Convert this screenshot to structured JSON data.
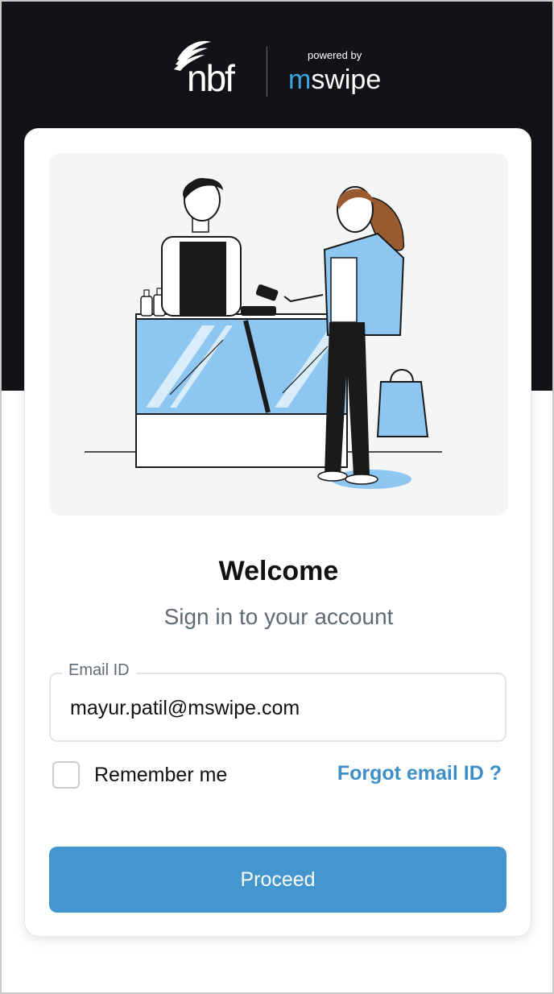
{
  "header": {
    "brand_primary": "nbf",
    "powered_by_label": "powered by",
    "brand_secondary_prefix": "m",
    "brand_secondary_suffix": "swipe"
  },
  "login": {
    "title": "Welcome",
    "subtitle": "Sign in to your account",
    "email_label": "Email ID",
    "email_value": "mayur.patil@mswipe.com",
    "remember_label": "Remember me",
    "remember_checked": false,
    "forgot_label": "Forgot email ID ?",
    "proceed_label": "Proceed"
  },
  "colors": {
    "header_background": "#121317",
    "accent_blue": "#4396ce",
    "link_blue": "#3d8fc6",
    "mswipe_accent": "#3aa6e0"
  },
  "icons": {
    "logo": "nbf-logo-icon",
    "illustration": "merchant-payment-illustration"
  }
}
